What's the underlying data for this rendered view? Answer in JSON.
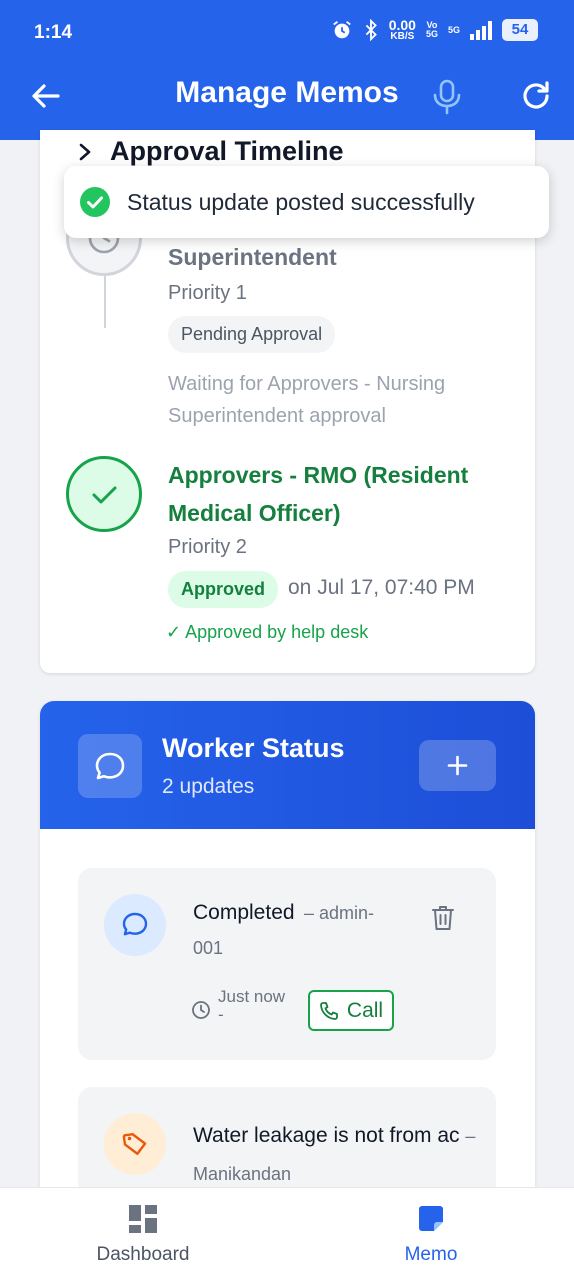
{
  "status_bar": {
    "time": "1:14",
    "net_speed_value": "0.00",
    "net_speed_unit": "KB/S",
    "volte_top": "Vo",
    "volte_bottom": "5G",
    "signal_label": "5G",
    "battery": "54"
  },
  "header": {
    "title": "Manage Memos"
  },
  "approval": {
    "section_title": "Approval Timeline",
    "stages": [
      {
        "title": "Superintendent",
        "priority": "Priority 1",
        "status": "Pending Approval",
        "note": "Waiting for Approvers - Nursing Superintendent approval"
      },
      {
        "title": "Approvers - RMO (Resident Medical Officer)",
        "priority": "Priority 2",
        "status": "Approved",
        "date": "on Jul 17, 07:40 PM",
        "approved_by": "✓ Approved by help desk"
      }
    ]
  },
  "toast": {
    "message": "Status update posted successfully"
  },
  "worker_status": {
    "title": "Worker Status",
    "count": "2 updates",
    "updates": [
      {
        "status": "Completed",
        "author_a": "– admin-",
        "author_b": "001",
        "time": "Just now",
        "time_suffix": "-",
        "call_label": "Call"
      },
      {
        "status": "Water leakage is not from ac",
        "author": "– Manikandan"
      }
    ]
  },
  "nav": {
    "dashboard": "Dashboard",
    "memo": "Memo"
  },
  "colors": {
    "primary": "#2563eb",
    "success": "#16a34a",
    "pending_bg": "#f3f4f6"
  }
}
